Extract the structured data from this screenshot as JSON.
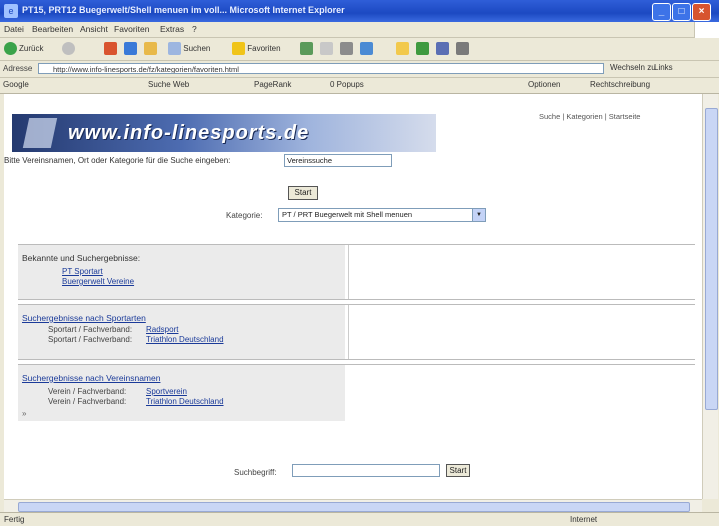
{
  "window": {
    "title": "PT15, PRT12 Buegerwelt/Shell menuen im voll... Microsoft Internet Explorer",
    "min_label": "_",
    "max_label": "□",
    "close_label": "×"
  },
  "menu": [
    "Datei",
    "Bearbeiten",
    "Ansicht",
    "Favoriten",
    "Extras",
    "?"
  ],
  "toolbar": {
    "back": "Zurück",
    "search": "Suchen",
    "favorites": "Favoriten"
  },
  "address": {
    "label": "Adresse",
    "url": "http://www.info-linesports.de/fz/kategorien/favoriten.html",
    "go": "Wechseln zu",
    "links": "Links"
  },
  "googlebar": {
    "label": "Google",
    "search": "Suche Web",
    "pagerank": "PageRank",
    "blocked": "0 Popups",
    "options": "Optionen",
    "check": "Rechtschreibung"
  },
  "page": {
    "banner_logo": "www.info-linesports.de",
    "top_link": "Suche | Kategorien | Startseite",
    "intro_text": "Bitte Vereinsnamen, Ort oder Kategorie für die Suche eingeben:",
    "intro_value": "Vereinssuche",
    "submit_label": "Start",
    "category_label": "Kategorie:",
    "category_value": "PT / PRT Buegerwelt mit Shell menuen",
    "sections": [
      {
        "header": "Bekannte und Suchergebnisse:",
        "links": [
          "PT Sportart",
          "Buergerwelt Vereine"
        ]
      },
      {
        "header": "Suchergebnisse nach Sportarten",
        "rows": [
          {
            "label": "Sportart / Fachverband:",
            "link": "Radsport"
          },
          {
            "label": "Sportart / Fachverband:",
            "link": "Triathlon Deutschland"
          }
        ]
      },
      {
        "header": "Suchergebnisse nach Vereinsnamen",
        "rows": [
          {
            "label": "Verein / Fachverband:",
            "link": "Sportverein"
          },
          {
            "label": "Verein / Fachverband:",
            "link": "Triathlon Deutschland"
          }
        ]
      }
    ],
    "search_label": "Suchbegriff:",
    "search_button": "Start"
  },
  "status": {
    "left": "Fertig",
    "right": "Internet"
  }
}
